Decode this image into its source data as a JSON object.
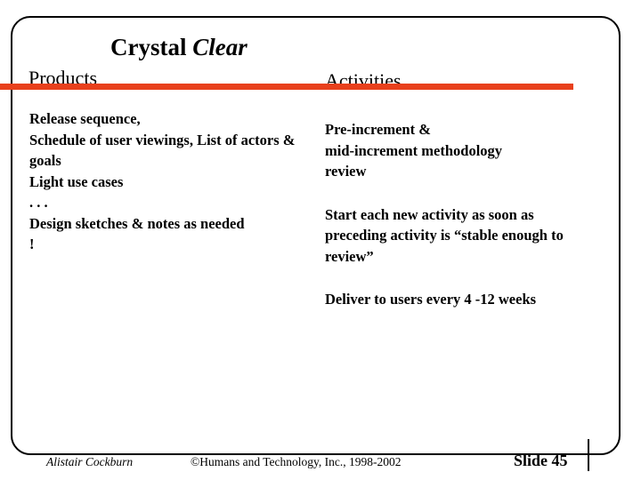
{
  "slide": {
    "title_main": "Crystal",
    "title_emphasis": "Clear",
    "accent_color": "#E8401C",
    "frame_color": "#000000"
  },
  "columns": {
    "products": {
      "heading": "Products",
      "paragraphs": [
        "Release sequence,\nSchedule of user viewings, List of actors & goals\nLight use cases\n. . .\nDesign sketches & notes as needed\n!"
      ]
    },
    "activities": {
      "heading": "Activities",
      "paragraphs": [
        "Pre-increment &\nmid-increment methodology\nreview",
        "Start each new activity as soon as preceding activity is “stable enough to review”",
        "Deliver to users every 4 -12 weeks"
      ]
    }
  },
  "footer": {
    "author": "Alistair Cockburn",
    "copyright": "©Humans and Technology, Inc., 1998-2002",
    "slide_number": "Slide 45"
  }
}
